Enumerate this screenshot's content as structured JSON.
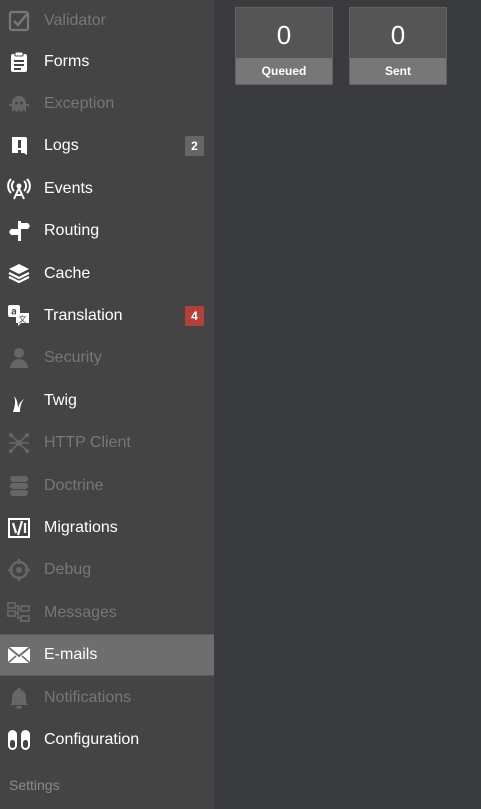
{
  "sidebar": {
    "items": [
      {
        "label": "Validator",
        "icon": "validator-check-icon",
        "enabled": false
      },
      {
        "label": "Forms",
        "icon": "clipboard-icon",
        "enabled": true
      },
      {
        "label": "Exception",
        "icon": "ghost-icon",
        "enabled": false
      },
      {
        "label": "Logs",
        "icon": "log-exclamation-icon",
        "enabled": true,
        "badge": "2",
        "badge_color": "#666666"
      },
      {
        "label": "Events",
        "icon": "broadcast-icon",
        "enabled": true
      },
      {
        "label": "Routing",
        "icon": "signpost-icon",
        "enabled": true
      },
      {
        "label": "Cache",
        "icon": "layers-icon",
        "enabled": true
      },
      {
        "label": "Translation",
        "icon": "translate-icon",
        "enabled": true,
        "badge": "4",
        "badge_color": "#b0413e"
      },
      {
        "label": "Security",
        "icon": "user-icon",
        "enabled": false
      },
      {
        "label": "Twig",
        "icon": "twig-icon",
        "enabled": true
      },
      {
        "label": "HTTP Client",
        "icon": "network-icon",
        "enabled": false
      },
      {
        "label": "Doctrine",
        "icon": "database-icon",
        "enabled": false
      },
      {
        "label": "Migrations",
        "icon": "migrations-icon",
        "enabled": true
      },
      {
        "label": "Debug",
        "icon": "crosshair-icon",
        "enabled": false
      },
      {
        "label": "Messages",
        "icon": "bus-icon",
        "enabled": false
      },
      {
        "label": "E-mails",
        "icon": "envelope-icon",
        "enabled": true,
        "selected": true
      },
      {
        "label": "Notifications",
        "icon": "bell-icon",
        "enabled": false
      },
      {
        "label": "Configuration",
        "icon": "toggle-icon",
        "enabled": true
      }
    ],
    "settings_label": "Settings"
  },
  "main": {
    "metrics": [
      {
        "value": "0",
        "label": "Queued"
      },
      {
        "value": "0",
        "label": "Sent"
      }
    ]
  },
  "colors": {
    "sidebar_bg": "#444444",
    "main_bg": "#393b3f",
    "selected_bg": "#6e6e6e",
    "disabled_text": "#777777",
    "badge_grey": "#666666",
    "badge_red": "#b0413e"
  }
}
